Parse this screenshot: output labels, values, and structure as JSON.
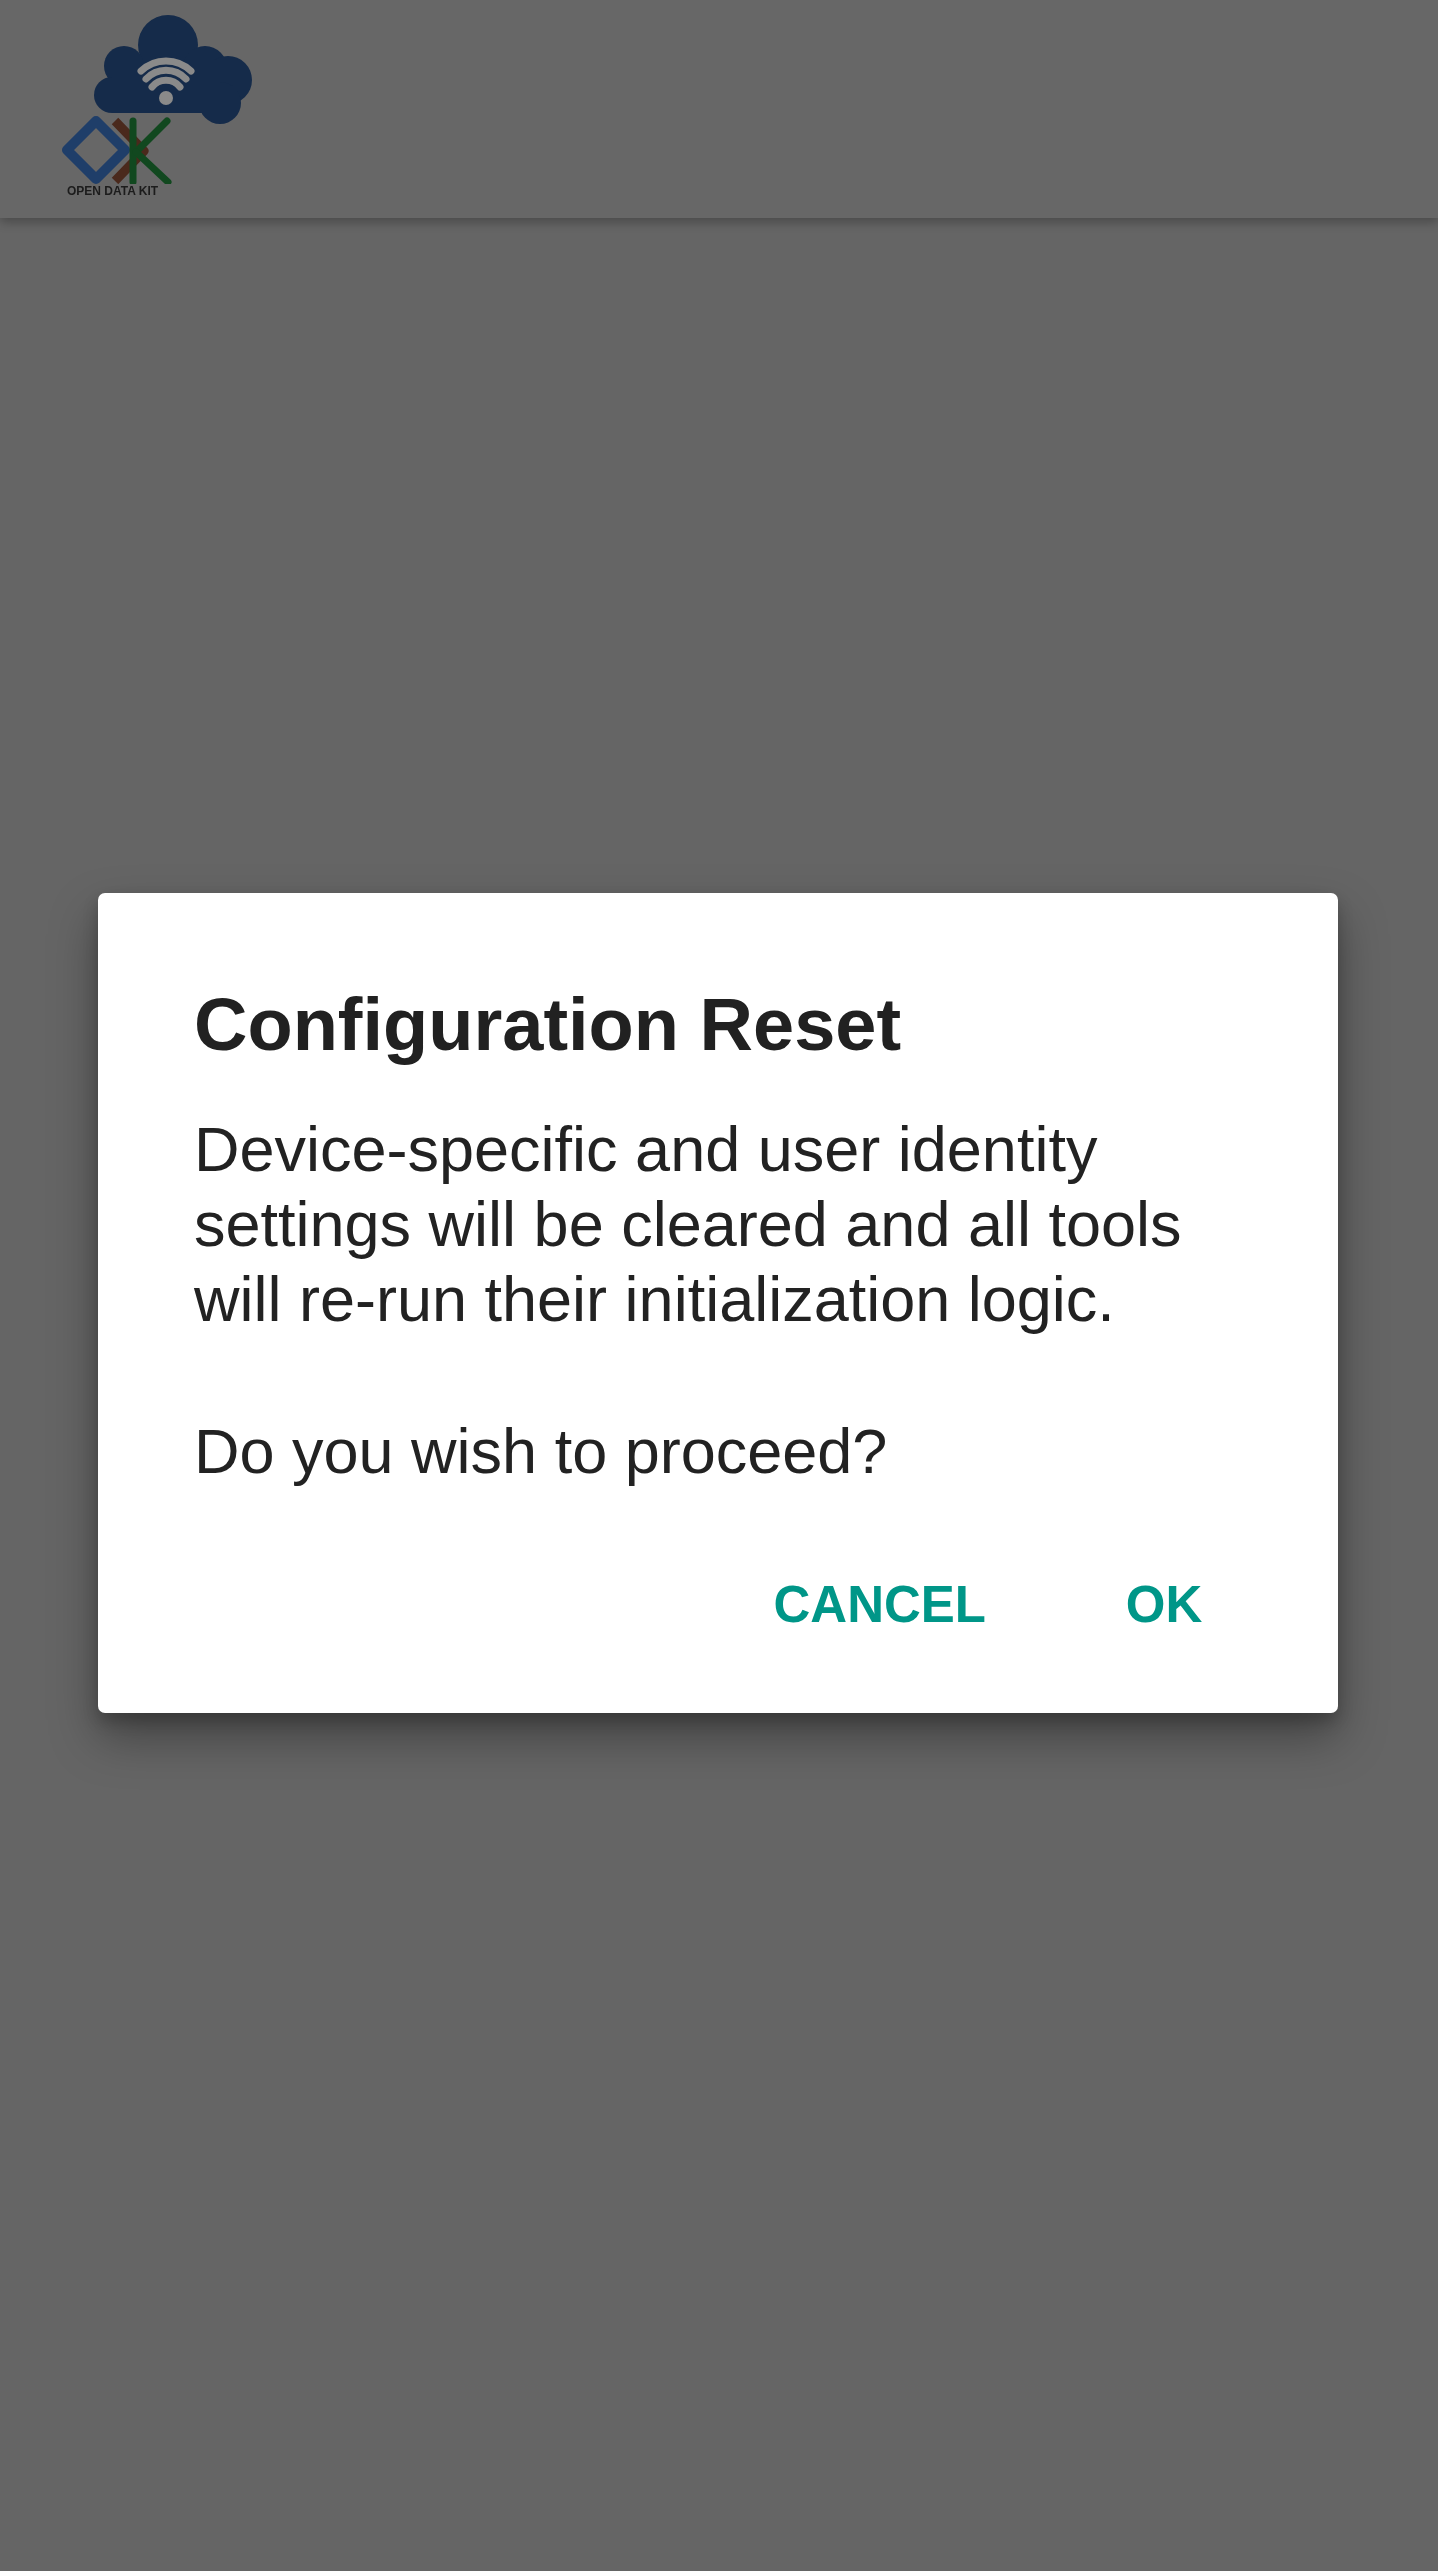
{
  "app_bar": {
    "logo_text": "OPEN DATA KIT"
  },
  "dialog": {
    "title": "Configuration Reset",
    "message": [
      "Device-specific and user identity settings will be cleared and all tools will re-run their initialization logic.",
      "Do you wish to proceed?"
    ],
    "buttons": [
      {
        "label": "CANCEL"
      },
      {
        "label": "OK"
      }
    ]
  }
}
